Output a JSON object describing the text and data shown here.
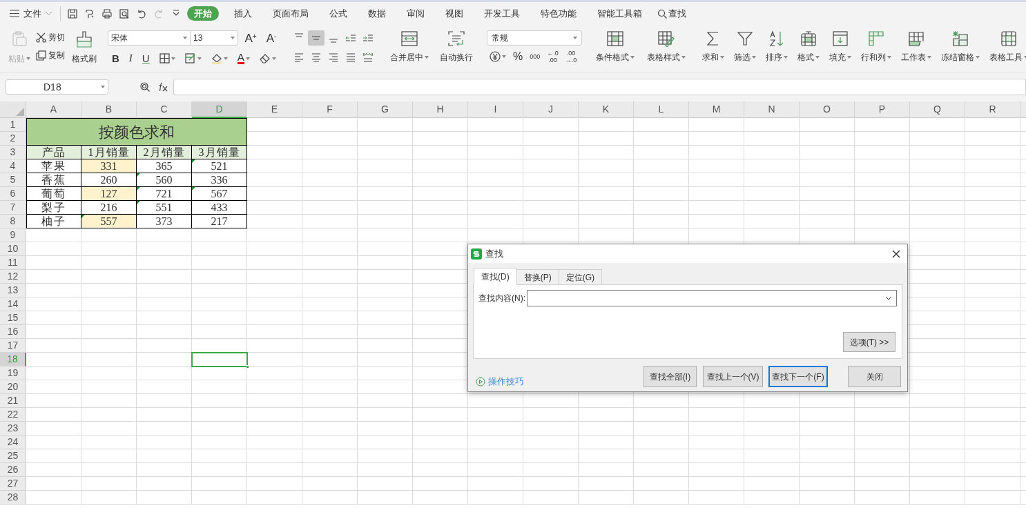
{
  "menu": {
    "file_label": "文件",
    "tabs": [
      {
        "label": "开始",
        "selected": true
      },
      {
        "label": "插入",
        "selected": false
      },
      {
        "label": "页面布局",
        "selected": false
      },
      {
        "label": "公式",
        "selected": false
      },
      {
        "label": "数据",
        "selected": false
      },
      {
        "label": "审阅",
        "selected": false
      },
      {
        "label": "视图",
        "selected": false
      },
      {
        "label": "开发工具",
        "selected": false
      },
      {
        "label": "特色功能",
        "selected": false
      },
      {
        "label": "智能工具箱",
        "selected": false
      }
    ],
    "search": "查找"
  },
  "ribbon": {
    "paste": {
      "label": "粘贴",
      "disabled": true
    },
    "cut": "剪切",
    "copy": "复制",
    "format_painter": "格式刷",
    "font_name": "宋体",
    "font_size": "13",
    "size_buttons": [
      {
        "letter": "A",
        "sign": "+"
      },
      {
        "letter": "A",
        "sign": "-"
      }
    ],
    "style_buttons": [
      "B",
      "I",
      "U"
    ],
    "font_color_letter": "A",
    "vertical_align": [
      {
        "selected": false
      },
      {
        "selected": true
      },
      {
        "selected": false
      }
    ],
    "number_format": "常规",
    "number_buttons": [
      "%",
      "000"
    ],
    "decimal_buttons": [
      {
        "top": "←.0",
        "bottom": ".00"
      },
      {
        "top": ".00",
        "bottom": "→.0"
      }
    ],
    "big_buttons": [
      {
        "label": "合并居中",
        "dropdown": true
      },
      {
        "label": "自动换行",
        "dropdown": false
      },
      {
        "label": "条件格式",
        "dropdown": true
      },
      {
        "label": "表格样式",
        "dropdown": true
      },
      {
        "label": "求和",
        "dropdown": true
      },
      {
        "label": "筛选",
        "dropdown": true
      },
      {
        "label": "排序",
        "dropdown": true
      },
      {
        "label": "格式",
        "dropdown": true
      },
      {
        "label": "填充",
        "dropdown": true
      },
      {
        "label": "行和列",
        "dropdown": true
      },
      {
        "label": "工作表",
        "dropdown": true
      },
      {
        "label": "冻结窗格",
        "dropdown": true
      },
      {
        "label": "表格工具",
        "dropdown": true
      }
    ]
  },
  "formula_bar": {
    "name_box": "D18"
  },
  "sheet": {
    "columns": [
      {
        "label": "A",
        "selected": false
      },
      {
        "label": "B",
        "selected": false
      },
      {
        "label": "C",
        "selected": false
      },
      {
        "label": "D",
        "selected": true
      },
      {
        "label": "E",
        "selected": false
      },
      {
        "label": "F",
        "selected": false
      },
      {
        "label": "G",
        "selected": false
      },
      {
        "label": "H",
        "selected": false
      },
      {
        "label": "I",
        "selected": false
      },
      {
        "label": "J",
        "selected": false
      },
      {
        "label": "K",
        "selected": false
      },
      {
        "label": "L",
        "selected": false
      },
      {
        "label": "M",
        "selected": false
      },
      {
        "label": "N",
        "selected": false
      },
      {
        "label": "O",
        "selected": false
      },
      {
        "label": "P",
        "selected": false
      },
      {
        "label": "Q",
        "selected": false
      },
      {
        "label": "R",
        "selected": false
      }
    ],
    "rows": [
      {
        "label": "1",
        "selected": false
      },
      {
        "label": "2",
        "selected": false
      },
      {
        "label": "3",
        "selected": false
      },
      {
        "label": "4",
        "selected": false
      },
      {
        "label": "5",
        "selected": false
      },
      {
        "label": "6",
        "selected": false
      },
      {
        "label": "7",
        "selected": false
      },
      {
        "label": "8",
        "selected": false
      },
      {
        "label": "9",
        "selected": false
      },
      {
        "label": "10",
        "selected": false
      },
      {
        "label": "11",
        "selected": false
      },
      {
        "label": "12",
        "selected": false
      },
      {
        "label": "13",
        "selected": false
      },
      {
        "label": "14",
        "selected": false
      },
      {
        "label": "15",
        "selected": false
      },
      {
        "label": "16",
        "selected": false
      },
      {
        "label": "17",
        "selected": false
      },
      {
        "label": "18",
        "selected": true
      },
      {
        "label": "19",
        "selected": false
      },
      {
        "label": "20",
        "selected": false
      },
      {
        "label": "21",
        "selected": false
      },
      {
        "label": "22",
        "selected": false
      },
      {
        "label": "23",
        "selected": false
      },
      {
        "label": "24",
        "selected": false
      },
      {
        "label": "25",
        "selected": false
      },
      {
        "label": "26",
        "selected": false
      },
      {
        "label": "27",
        "selected": false
      },
      {
        "label": "28",
        "selected": false
      }
    ],
    "table_title": "按颜色求和",
    "table_header": [
      "产品",
      "1月销量",
      "2月销量",
      "3月销量"
    ],
    "table_rows": [
      {
        "product": "苹果",
        "values": [
          {
            "text": "331",
            "highlighted": true,
            "flag": false
          },
          {
            "text": "365",
            "highlighted": false,
            "flag": false
          },
          {
            "text": "521",
            "highlighted": false,
            "flag": true
          }
        ]
      },
      {
        "product": "香蕉",
        "values": [
          {
            "text": "260",
            "highlighted": false,
            "flag": false
          },
          {
            "text": "560",
            "highlighted": false,
            "flag": true
          },
          {
            "text": "336",
            "highlighted": false,
            "flag": false
          }
        ]
      },
      {
        "product": "葡萄",
        "values": [
          {
            "text": "127",
            "highlighted": true,
            "flag": false
          },
          {
            "text": "721",
            "highlighted": false,
            "flag": true
          },
          {
            "text": "567",
            "highlighted": false,
            "flag": true
          }
        ]
      },
      {
        "product": "梨子",
        "values": [
          {
            "text": "216",
            "highlighted": false,
            "flag": false
          },
          {
            "text": "551",
            "highlighted": false,
            "flag": true
          },
          {
            "text": "433",
            "highlighted": false,
            "flag": false
          }
        ]
      },
      {
        "product": "柚子",
        "values": [
          {
            "text": "557",
            "highlighted": true,
            "flag": true
          },
          {
            "text": "373",
            "highlighted": false,
            "flag": false
          },
          {
            "text": "217",
            "highlighted": false,
            "flag": false
          }
        ]
      }
    ]
  },
  "dialog": {
    "title": "查找",
    "tabs": [
      {
        "label": "查找(D)",
        "selected": true
      },
      {
        "label": "替换(P)",
        "selected": false
      },
      {
        "label": "定位(G)",
        "selected": false
      }
    ],
    "field_label": "查找内容(N):",
    "options_button": "选项(T) >>",
    "tips_link": "操作技巧",
    "buttons": [
      {
        "label": "查找全部(I)",
        "focused": false
      },
      {
        "label": "查找上一个(V)",
        "focused": false
      },
      {
        "label": "查找下一个(F)",
        "focused": true
      },
      {
        "label": "关闭",
        "focused": false
      }
    ]
  }
}
